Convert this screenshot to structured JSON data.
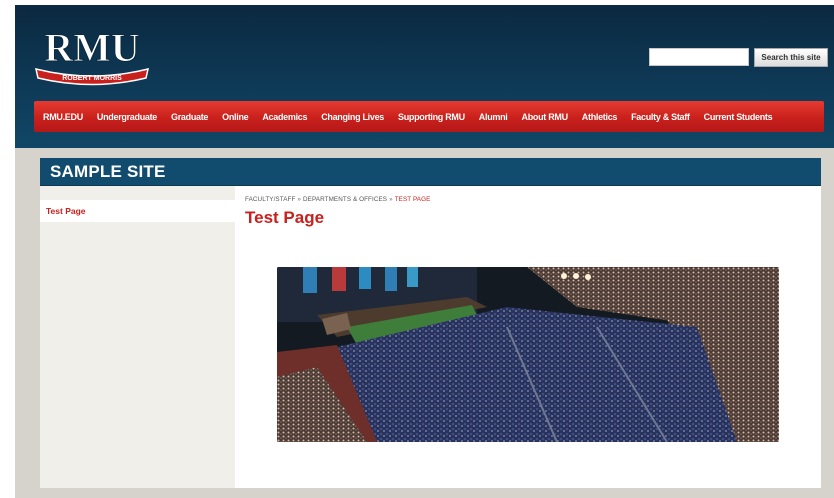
{
  "header": {
    "logo": {
      "wordmark": "RMU",
      "ribbon": "ROBERT MORRIS"
    },
    "search": {
      "placeholder": "",
      "button_label": "Search this site"
    },
    "nav": [
      "RMU.EDU",
      "Undergraduate",
      "Graduate",
      "Online",
      "Academics",
      "Changing Lives",
      "Supporting RMU",
      "Alumni",
      "About RMU",
      "Athletics",
      "Faculty & Staff",
      "Current Students"
    ]
  },
  "site": {
    "title": "SAMPLE SITE"
  },
  "sidebar": {
    "items": [
      {
        "label": "Test Page"
      }
    ]
  },
  "main": {
    "breadcrumb": {
      "items": [
        "FACULTY/STAFF",
        "DEPARTMENTS & OFFICES"
      ],
      "separator": "»",
      "current": "TEST PAGE"
    },
    "title": "Test Page",
    "image": {
      "alt": "commencement-ceremony-photo"
    }
  },
  "colors": {
    "header_bg": "#0e3956",
    "nav_red": "#c9201b",
    "site_bar": "#114c6e",
    "accent_red": "#c8201d",
    "sidebar_bg": "#f1efe9",
    "canvas_gray": "#d6d3cc"
  }
}
